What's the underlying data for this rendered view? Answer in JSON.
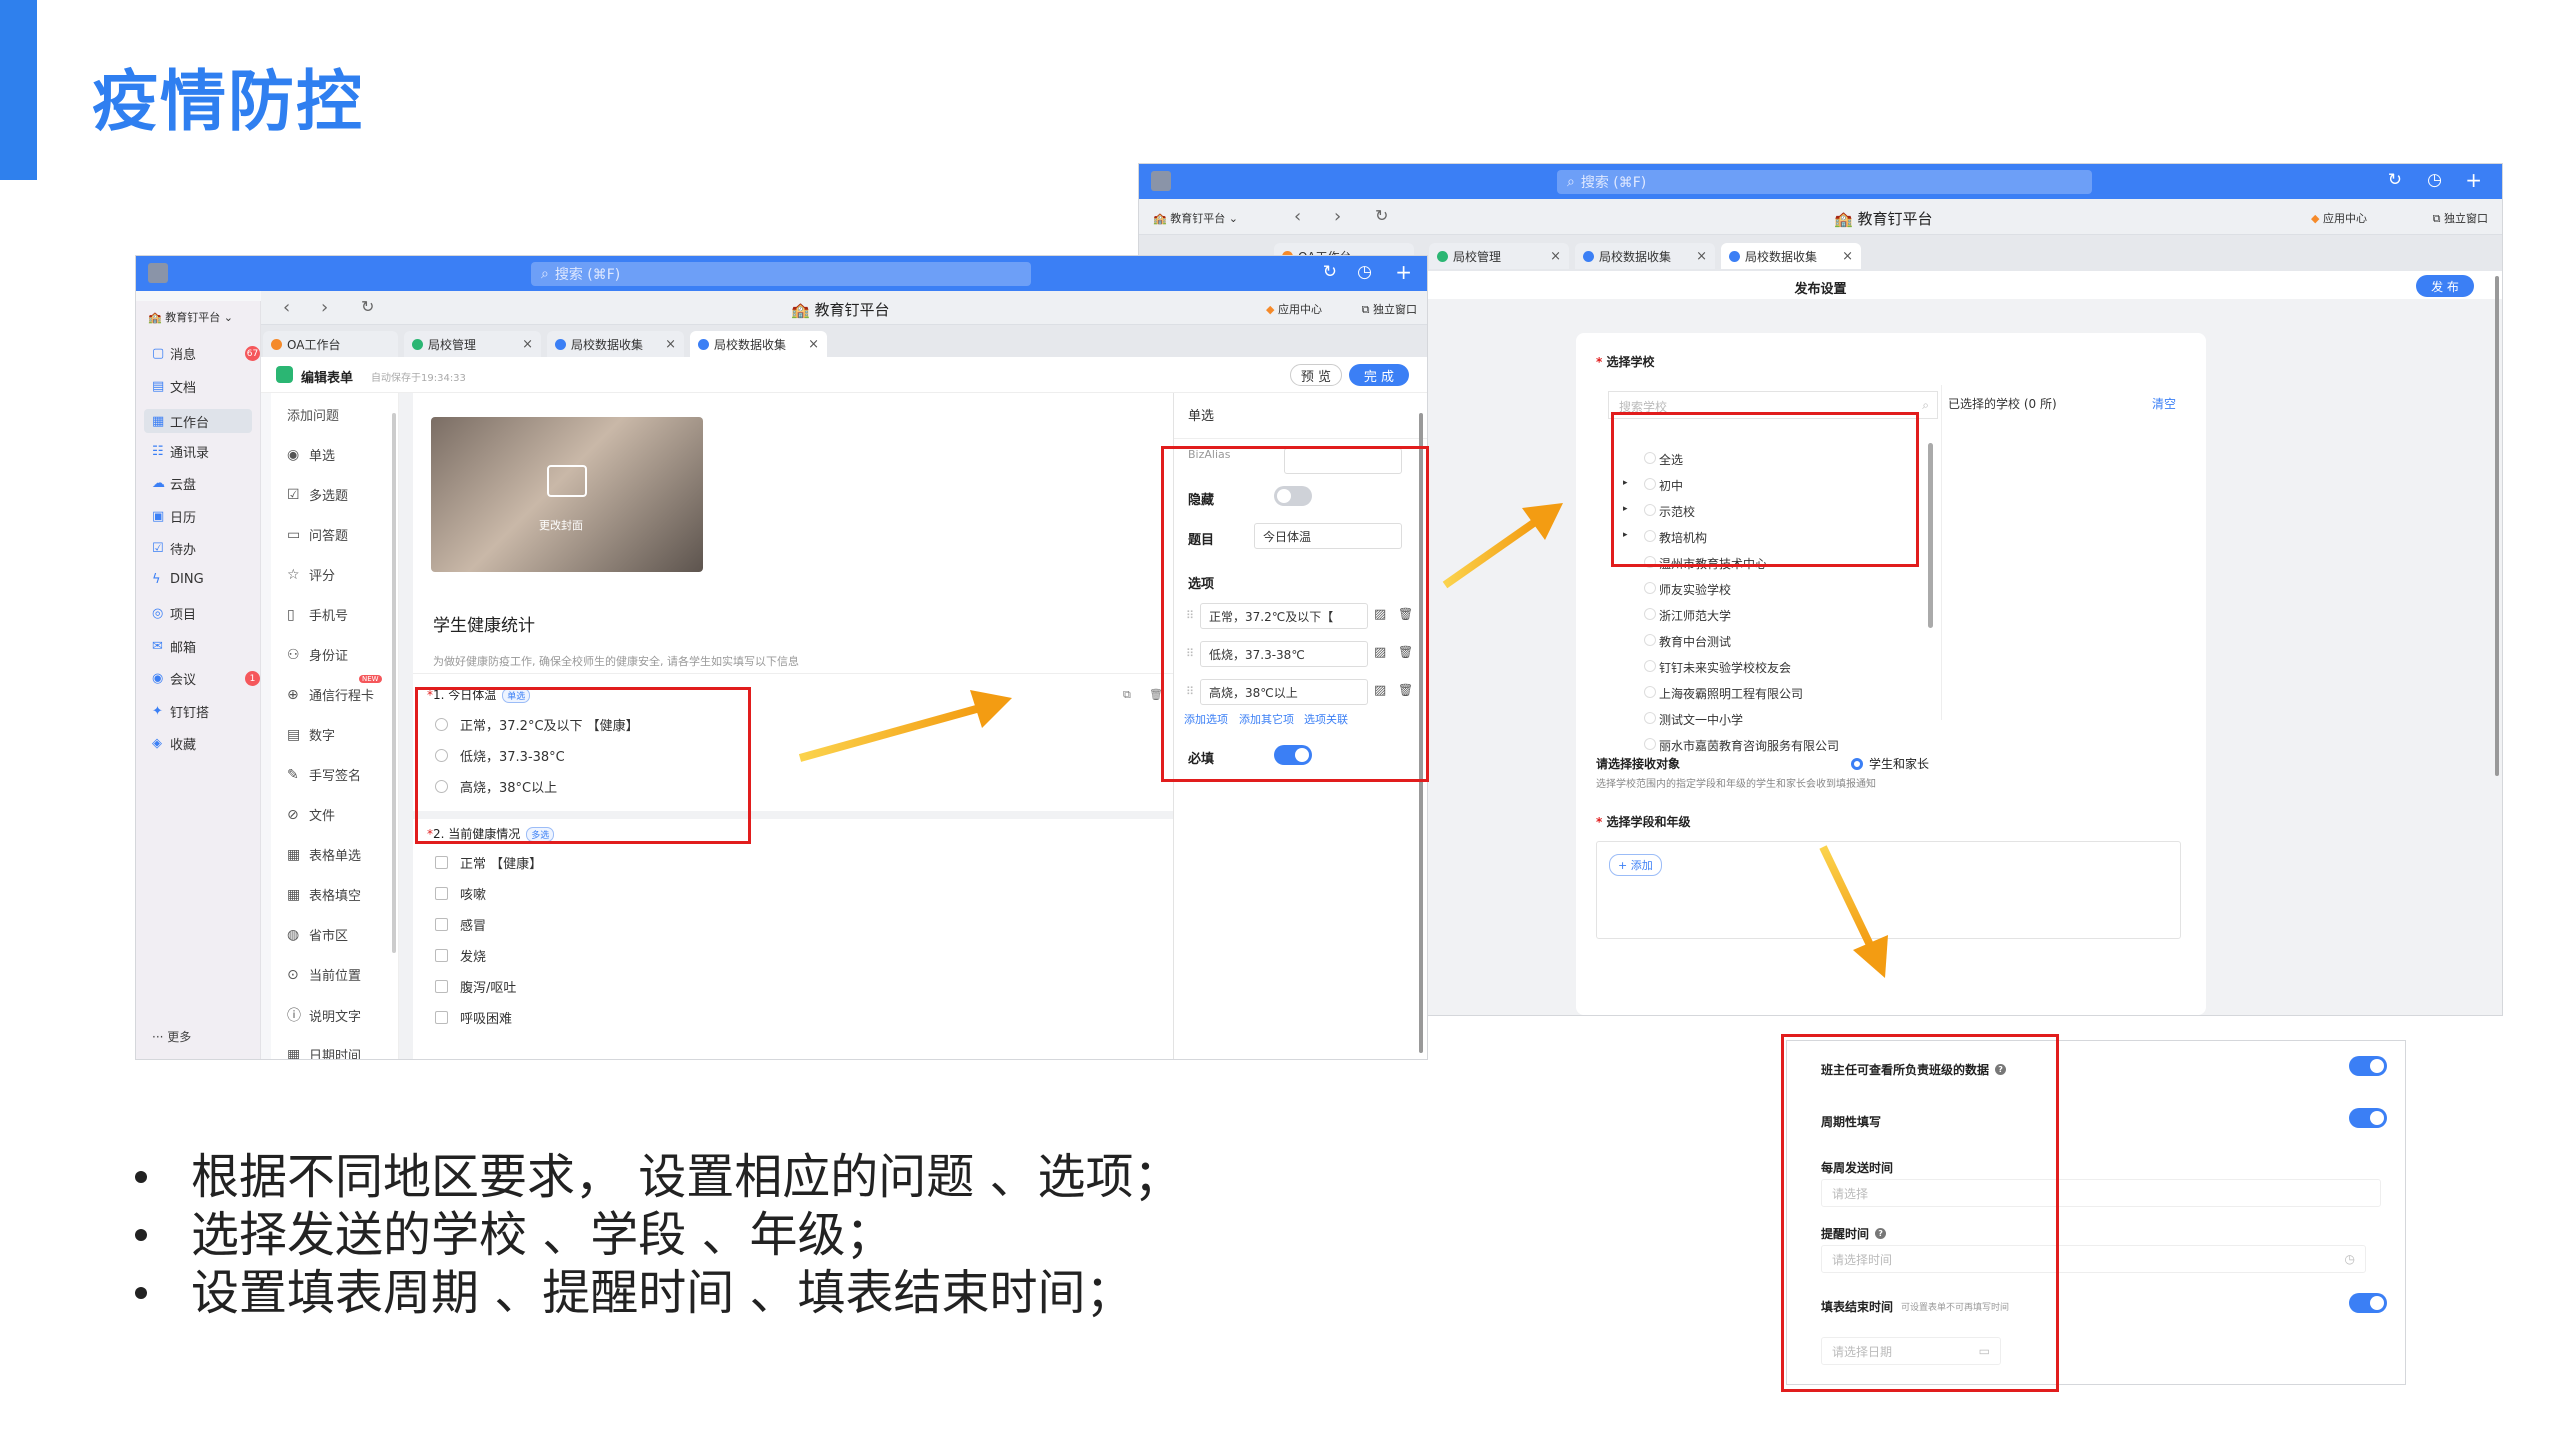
{
  "slide_title": "疫情防控",
  "bullets": [
    "根据不同地区要求， 设置相应的问题 、选项；",
    "选择发送的学校 、学段 、年级；",
    "设置填表周期 、提醒时间 、填表结束时间；"
  ],
  "left_window": {
    "search_placeholder": "搜索 (⌘F)",
    "org_name": "教育钉平台",
    "platform_title": "教育钉平台",
    "app_center": "应用中心",
    "standalone": "独立窗口",
    "tabs": [
      "OA工作台",
      "局校管理",
      "局校数据收集",
      "局校数据收集"
    ],
    "sidebar": [
      {
        "label": "消息",
        "icon": "message-icon",
        "badge": "67"
      },
      {
        "label": "文档",
        "icon": "doc-icon"
      },
      {
        "label": "工作台",
        "icon": "workbench-icon"
      },
      {
        "label": "通讯录",
        "icon": "contacts-icon"
      },
      {
        "label": "云盘",
        "icon": "cloud-icon"
      },
      {
        "label": "日历",
        "icon": "calendar-icon"
      },
      {
        "label": "待办",
        "icon": "todo-icon"
      },
      {
        "label": "DING",
        "icon": "ding-icon"
      },
      {
        "label": "项目",
        "icon": "project-icon"
      },
      {
        "label": "邮箱",
        "icon": "mail-icon"
      },
      {
        "label": "会议",
        "icon": "meeting-icon",
        "badge": "1"
      },
      {
        "label": "钉钉搭",
        "icon": "builder-icon"
      },
      {
        "label": "收藏",
        "icon": "favorite-icon"
      }
    ],
    "more": "··· 更多",
    "editor_title": "编辑表单",
    "autosave": "自动保存于19:34:33",
    "preview_btn": "预 览",
    "done_btn": "完 成",
    "add_question": "添加问题",
    "question_types": [
      "单选",
      "多选题",
      "问答题",
      "评分",
      "手机号",
      "身份证",
      "通信行程卡",
      "数字",
      "手写签名",
      "文件",
      "表格单选",
      "表格填空",
      "省市区",
      "当前位置",
      "说明文字",
      "日期时间"
    ],
    "new_badge": "NEW",
    "cover_label": "更改封面",
    "form_title": "学生健康统计",
    "form_desc": "为做好健康防疫工作, 确保全校师生的健康安全, 请各学生如实填写以下信息",
    "q1": {
      "title": "1. 今日体温",
      "tag": "单选",
      "options": [
        "正常，37.2°C及以下 【健康】",
        "低烧，37.3-38°C",
        "高烧，38°C以上"
      ]
    },
    "q2": {
      "title": "2. 当前健康情况",
      "tag": "多选",
      "options": [
        "正常 【健康】",
        "咳嗽",
        "感冒",
        "发烧",
        "腹泻/呕吐",
        "呼吸困难"
      ]
    },
    "props": {
      "header": "单选",
      "bizalias": "BizAlias",
      "hide_label": "隐藏",
      "title_label": "题目",
      "title_value": "今日体温",
      "options_label": "选项",
      "options": [
        "正常，37.2℃及以下【",
        "低烧，37.3-38℃",
        "高烧，38℃以上"
      ],
      "links": [
        "添加选项",
        "添加其它项",
        "选项关联"
      ],
      "required_label": "必填"
    }
  },
  "right_window": {
    "search_placeholder": "搜索 (⌘F)",
    "org_name": "教育钉平台",
    "platform_title": "教育钉平台",
    "app_center": "应用中心",
    "standalone": "独立窗口",
    "tabs": [
      "OA工作台",
      "局校管理",
      "局校数据收集",
      "局校数据收集"
    ],
    "header": "发布设置",
    "publish_btn": "发 布",
    "select_school_label": "选择学校",
    "search_school_placeholder": "搜索学校",
    "selected_label": "已选择的学校 (0 所)",
    "clear": "清空",
    "schools": [
      "全选",
      "初中",
      "示范校",
      "教培机构",
      "温州市教育技术中心",
      "师友实验学校",
      "浙江师范大学",
      "教育中台测试",
      "钉钉未来实验学校校友会",
      "上海夜霸照明工程有限公司",
      "测试文一中小学",
      "丽水市嘉茵教育咨询服务有限公司"
    ],
    "receiver_label": "请选择接收对象",
    "receiver_option": "学生和家长",
    "receiver_desc": "选择学校范围内的指定学段和年级的学生和家长会收到填报通知",
    "grade_label": "选择学段和年级",
    "add_btn": "+ 添加"
  },
  "settings_panel": {
    "teacher_view": "班主任可查看所负责班级的数据",
    "periodic": "周期性填写",
    "weekly_time": "每周发送时间",
    "weekly_placeholder": "请选择",
    "reminder": "提醒时间",
    "reminder_placeholder": "请选择时间",
    "end_time": "填表结束时间",
    "end_time_hint": "可设置表单不可再填写时间",
    "end_placeholder": "请选择日期"
  },
  "colors": {
    "accent": "#2f7ff0",
    "highlight_box": "#e11d1d",
    "arrow": "#f5a623"
  }
}
